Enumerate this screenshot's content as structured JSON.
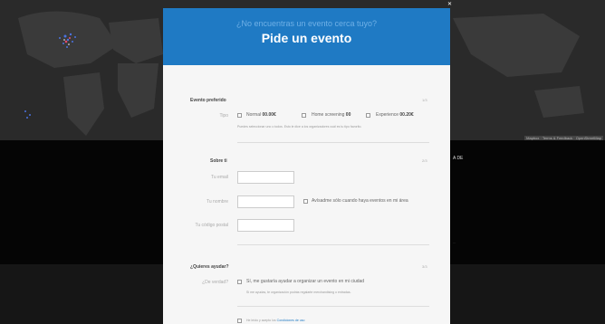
{
  "background": {
    "map_attribution": "Mapbox · Terms & Feedback · OpenStreetMap",
    "right_text": "A DE",
    "right_small": "..."
  },
  "modal": {
    "subtitle": "¿No encuentras un evento cerca tuyo?",
    "title": "Pide un evento"
  },
  "section1": {
    "title": "Evento preferido",
    "step": "1/3",
    "type_label": "Tipo",
    "options": [
      {
        "name": "Normal",
        "price": "00.00€"
      },
      {
        "name": "Home screening",
        "price": "00"
      },
      {
        "name": "Experience",
        "price": "00.20€"
      }
    ],
    "hint": "Puedes seleccionar uno o todos. Esto le dice a los organizadores cuál es tu tipo favorito."
  },
  "section2": {
    "title": "Sobre ti",
    "step": "2/3",
    "email_label": "Tu email",
    "name_label": "Tu nombre",
    "postcode_label": "Tu código postal",
    "notify_label": "Avísadme sólo cuando haya eventos en mi área"
  },
  "section3": {
    "title": "¿Quieres ayudar?",
    "step": "3/3",
    "really_label": "¿De verdad?",
    "help_label": "Sí, me gustaría ayudar a organizar un evento en mi ciudad",
    "help_hint": "Si me ayudas, te organización podrás regalarte merchandising o entradas.",
    "terms_prefix": "He leído y acepto los",
    "terms_link": "Condiciones de uso"
  },
  "colors": {
    "header_blue": "#1f7ac4",
    "header_sub": "#6fb0e6",
    "modal_bg": "#f6f6f6"
  }
}
